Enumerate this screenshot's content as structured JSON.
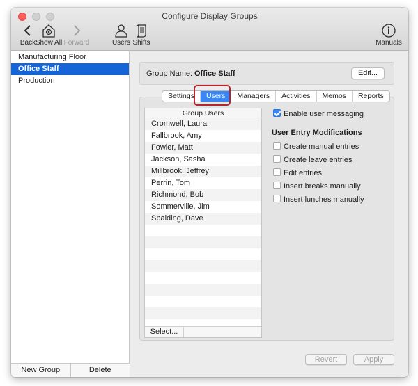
{
  "window": {
    "title": "Configure Display Groups"
  },
  "toolbar": {
    "back": {
      "label": "Back",
      "icon": "chevron-left-icon"
    },
    "show_all": {
      "label": "Show All",
      "icon": "gear-house-icon"
    },
    "forward": {
      "label": "Forward",
      "icon": "chevron-right-icon",
      "disabled": true
    },
    "users": {
      "label": "Users",
      "icon": "person-icon"
    },
    "shifts": {
      "label": "Shifts",
      "icon": "scroll-icon"
    },
    "manuals": {
      "label": "Manuals",
      "icon": "info-icon"
    }
  },
  "sidebar": {
    "items": [
      {
        "label": "Manufacturing Floor",
        "selected": false
      },
      {
        "label": "Office Staff",
        "selected": true
      },
      {
        "label": "Production",
        "selected": false
      }
    ],
    "new_group_label": "New Group",
    "delete_label": "Delete"
  },
  "group": {
    "name_label": "Group Name:",
    "name_value": "Office Staff",
    "edit_label": "Edit..."
  },
  "tabs": [
    {
      "label": "Settings",
      "active": false
    },
    {
      "label": "Users",
      "active": true
    },
    {
      "label": "Managers",
      "active": false
    },
    {
      "label": "Activities",
      "active": false
    },
    {
      "label": "Memos",
      "active": false
    },
    {
      "label": "Reports",
      "active": false
    }
  ],
  "users_list": {
    "header": "Group Users",
    "rows": [
      "Cromwell, Laura",
      "Fallbrook, Amy",
      "Fowler, Matt",
      "Jackson, Sasha",
      "Millbrook, Jeffrey",
      "Perrin, Tom",
      "Richmond, Bob",
      "Sommerville, Jim",
      "Spalding, Dave"
    ],
    "select_label": "Select..."
  },
  "options": {
    "enable_messaging": {
      "label": "Enable user messaging",
      "checked": true
    },
    "section_title": "User Entry Modifications",
    "checkboxes": [
      {
        "label": "Create manual entries",
        "checked": false
      },
      {
        "label": "Create leave entries",
        "checked": false
      },
      {
        "label": "Edit entries",
        "checked": false
      },
      {
        "label": "Insert breaks manually",
        "checked": false
      },
      {
        "label": "Insert lunches manually",
        "checked": false
      }
    ]
  },
  "footer": {
    "revert_label": "Revert",
    "apply_label": "Apply"
  },
  "colors": {
    "accent": "#1665d8",
    "tab_active": "#3a86f5",
    "highlight": "#b8232f",
    "close": "#fc605c"
  }
}
